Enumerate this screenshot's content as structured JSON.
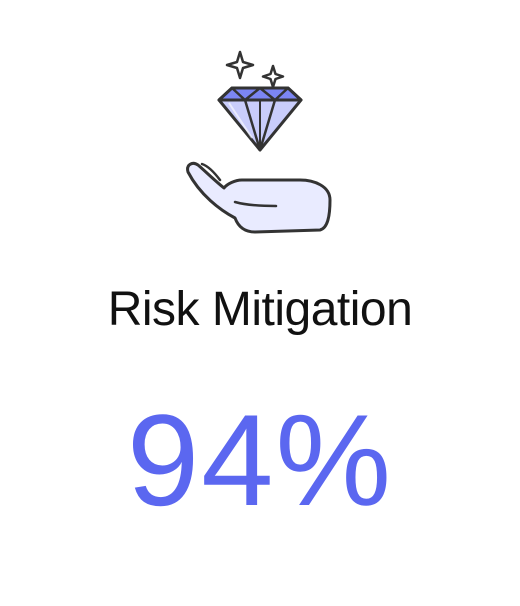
{
  "metric": {
    "title": "Risk Mitigation",
    "value": "94%"
  },
  "illustration": {
    "icon": "hand-holding-diamond-icon",
    "accent_color": "#5b67f0",
    "fill_light": "#e9ebff"
  },
  "colors": {
    "text": "#111111",
    "accent": "#5b67f0",
    "background": "#ffffff"
  }
}
